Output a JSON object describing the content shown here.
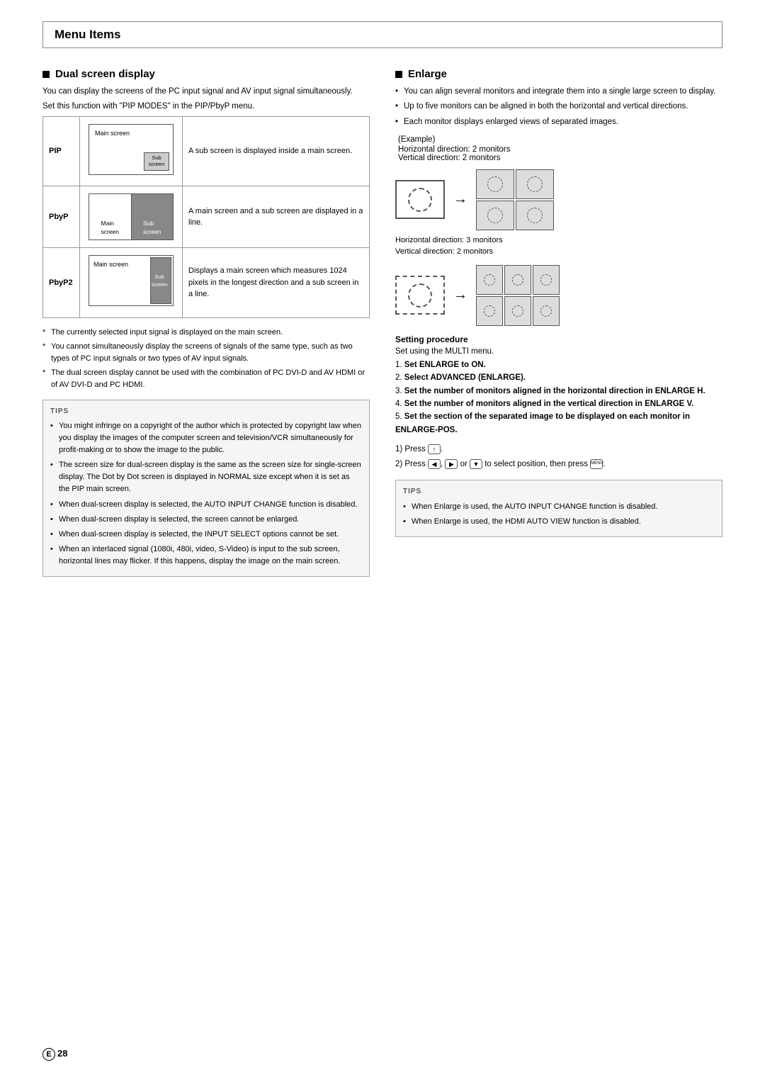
{
  "page": {
    "title": "Menu Items",
    "page_number": "28",
    "page_number_prefix": "E"
  },
  "dual_screen": {
    "section_title": "Dual screen display",
    "intro1": "You can display the screens of the PC input signal and AV input signal simultaneously.",
    "intro2": "Set this function with \"PIP MODES\" in the PIP/PbyP menu.",
    "pip_rows": [
      {
        "label": "PIP",
        "desc": "A sub screen is displayed inside a main screen.",
        "main_label": "Main screen",
        "sub_label": "Sub\nscreen"
      },
      {
        "label": "PbyP",
        "desc": "A main screen and a sub screen are displayed in a line.",
        "main_label": "Main\nscreen",
        "sub_label": "Sub\nscreen"
      },
      {
        "label": "PbyP2",
        "desc": "Displays a main screen which measures 1024 pixels in the longest direction and a sub screen in a line.",
        "main_label": "Main screen",
        "sub_label": "Sub\nscreen"
      }
    ],
    "notes": [
      "The currently selected input signal is displayed on the main screen.",
      "You cannot simultaneously display the screens of signals of the same type, such as two types of PC input signals or two types of AV input signals.",
      "The dual screen display cannot be used with the combination of PC DVI-D and AV HDMI or of AV DVI-D and PC HDMI."
    ],
    "tips_label": "TIPS",
    "tips": [
      "You might infringe on a copyright of the author which is protected by copyright law when you display the images of the computer screen and television/VCR simultaneously for profit-making or to show the image to the public.",
      "The screen size for dual-screen display is the same as the screen size for single-screen display. The Dot by Dot screen is displayed in NORMAL size except when it is set as the PIP main screen.",
      "When dual-screen display is selected, the AUTO INPUT CHANGE function is disabled.",
      "When dual-screen display is selected, the screen cannot be enlarged.",
      "When dual-screen display is selected, the INPUT SELECT options cannot be set.",
      "When an interlaced signal (1080i, 480i, video, S-Video) is input to the sub screen, horizontal lines may flicker. If this happens, display the image on the main screen."
    ]
  },
  "enlarge": {
    "section_title": "Enlarge",
    "bullets": [
      "You can align several monitors and integrate them into a single large screen to display.",
      "Up to five monitors can be aligned in both the horizontal and vertical directions.",
      "Each monitor displays enlarged views of separated images."
    ],
    "example_label": "(Example)",
    "example_horiz1": "Horizontal direction: 2 monitors",
    "example_vert1": "Vertical direction: 2 monitors",
    "example_horiz2": "Horizontal direction: 3 monitors",
    "example_vert2": "Vertical direction: 2 monitors",
    "setting_procedure_title": "Setting procedure",
    "setting_intro": "Set using the MULTI menu.",
    "steps": [
      {
        "num": "1",
        "text": "Set ENLARGE to ON.",
        "bold": true
      },
      {
        "num": "2",
        "text": "Select ADVANCED (ENLARGE).",
        "bold": true
      },
      {
        "num": "3",
        "text": "Set the number of monitors aligned in the horizontal direction in ENLARGE H.",
        "bold": true
      },
      {
        "num": "4",
        "text": "Set the number of monitors aligned in the vertical direction in ENLARGE V.",
        "bold": true
      },
      {
        "num": "5",
        "text": "Set the section of the separated image to be displayed on each monitor in ENLARGE-POS.",
        "bold": true
      }
    ],
    "sub_steps": [
      "1) Press [button1].",
      "2) Press [button2], [button3] or [button4] to select position, then press [button5]."
    ],
    "tips_label": "TIPS",
    "tips": [
      "When Enlarge is used, the AUTO INPUT CHANGE function is disabled.",
      "When Enlarge is used, the HDMI AUTO VIEW function is disabled."
    ]
  }
}
